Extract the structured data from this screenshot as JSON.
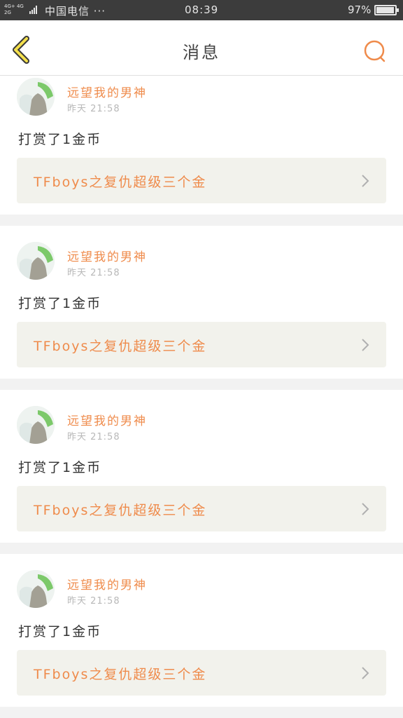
{
  "status_bar": {
    "network_top": "4G+ 4G",
    "network_bottom": "2G",
    "carrier": "中国电信 ···",
    "time": "08:39",
    "battery_percent_text": "97%",
    "battery_level": 0.97
  },
  "nav": {
    "title": "消息",
    "back_icon": "chevron-left-icon",
    "search_icon": "search-icon",
    "accent_color": "#ef8b4b"
  },
  "messages": [
    {
      "user_name": "远望我的男神",
      "timestamp": "昨天 21:58",
      "action": "打赏了1金币",
      "link_text": "TFboys之复仇超级三个金"
    },
    {
      "user_name": "远望我的男神",
      "timestamp": "昨天 21:58",
      "action": "打赏了1金币",
      "link_text": "TFboys之复仇超级三个金"
    },
    {
      "user_name": "远望我的男神",
      "timestamp": "昨天 21:58",
      "action": "打赏了1金币",
      "link_text": "TFboys之复仇超级三个金"
    },
    {
      "user_name": "远望我的男神",
      "timestamp": "昨天 21:58",
      "action": "打赏了1金币",
      "link_text": "TFboys之复仇超级三个金"
    }
  ]
}
